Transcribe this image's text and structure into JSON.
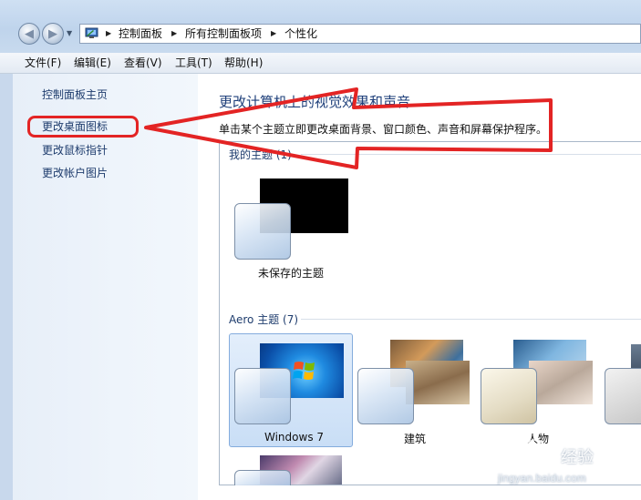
{
  "address": {
    "crumbs": [
      "控制面板",
      "所有控制面板项",
      "个性化"
    ]
  },
  "menu": [
    "文件(F)",
    "编辑(E)",
    "查看(V)",
    "工具(T)",
    "帮助(H)"
  ],
  "sidebar": {
    "items": [
      "控制面板主页",
      "更改桌面图标",
      "更改鼠标指针",
      "更改帐户图片"
    ]
  },
  "main": {
    "title": "更改计算机上的视觉效果和声音",
    "description": "单击某个主题立即更改桌面背景、窗口颜色、声音和屏幕保护程序。"
  },
  "groups": {
    "my_themes": {
      "label": "我的主题 (1)",
      "items": [
        "未保存的主题"
      ]
    },
    "aero_themes": {
      "label": "Aero 主题 (7)",
      "items": [
        "Windows 7",
        "建筑",
        "人物"
      ]
    }
  },
  "watermark": {
    "brand": "经验",
    "url": "jingyan.baidu.com"
  },
  "colors": {
    "annotation_red": "#e32424",
    "link_blue": "#1e3c6d",
    "title_blue": "#1e3f7a"
  }
}
